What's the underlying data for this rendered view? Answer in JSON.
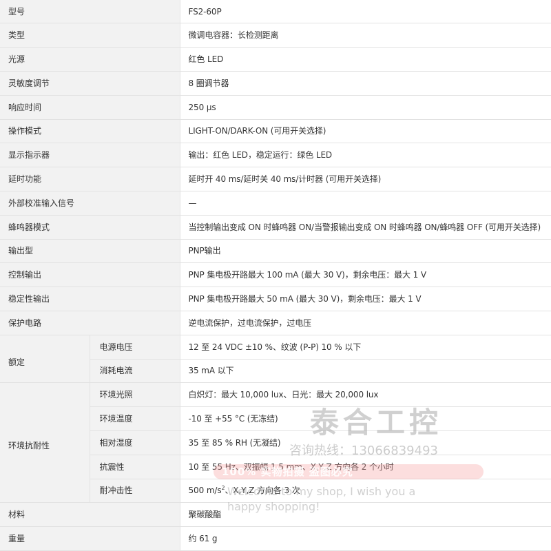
{
  "spec_table": {
    "rows": [
      {
        "label": "型号",
        "value": "FS2-60P"
      },
      {
        "label": "类型",
        "value": "微调电容器：长检测距离"
      },
      {
        "label": "光源",
        "value": "红色 LED"
      },
      {
        "label": "灵敏度调节",
        "value": "8 圈调节器"
      },
      {
        "label": "响应时间",
        "value": "250 μs"
      },
      {
        "label": "操作模式",
        "value": "LIGHT-ON/DARK-ON (可用开关选择)"
      },
      {
        "label": "显示指示器",
        "value": "输出：红色 LED，稳定运行：绿色 LED"
      },
      {
        "label": "延时功能",
        "value": "延时开 40 ms/延时关 40 ms/计时器 (可用开关选择)"
      },
      {
        "label": "外部校准输入信号",
        "value": "—"
      },
      {
        "label": "蜂鸣器模式",
        "value": "当控制输出变成 ON 时蜂鸣器 ON/当警报输出变成 ON 时蜂鸣器 ON/蜂鸣器 OFF (可用开关选择)"
      },
      {
        "label": "输出型",
        "value": "PNP输出"
      },
      {
        "label": "控制输出",
        "value": "PNP 集电极开路最大 100 mA (最大 30 V)，剩余电压：最大 1 V"
      },
      {
        "label": "稳定性输出",
        "value": "PNP 集电极开路最大 50 mA (最大 30 V)，剩余电压：最大 1 V"
      },
      {
        "label": "保护电路",
        "value": "逆电流保护，过电流保护，过电压"
      }
    ],
    "rated": {
      "label": "额定",
      "items": [
        {
          "label": "电源电压",
          "value": "12 至 24 VDC ±10 %、纹波 (P-P) 10 % 以下"
        },
        {
          "label": "消耗电流",
          "value": "35 mA 以下"
        }
      ]
    },
    "environment": {
      "label": "环境抗耐性",
      "items": [
        {
          "label": "环境光照",
          "value": "白炽灯：最大 10,000 lux、日光：最大 20,000 lux"
        },
        {
          "label": "环境温度",
          "value": "-10 至 +55 °C (无冻结)"
        },
        {
          "label": "相对湿度",
          "value": "35 至 85 % RH (无凝结)"
        },
        {
          "label": "抗震性",
          "value": "10 至 55 Hz、双振幅 1.5 mm、X,Y,Z 方向各 2 个小时"
        },
        {
          "label": "耐冲击性",
          "value_prefix": "500 m/s",
          "value_sup": "2",
          "value_suffix": "、X,Y,Z 方向各 3 次"
        }
      ]
    },
    "tail_rows": [
      {
        "label": "材料",
        "value": "聚碳酸酯"
      },
      {
        "label": "重量",
        "value": "约 61 g"
      }
    ]
  },
  "watermark": {
    "brand": "泰合工控",
    "phone": "咨询热线：13066839493",
    "banner": "100% 实物拍摄 盗图必究",
    "english_line1": "Welcome to my shop, I wish you a",
    "english_line2": "happy shopping!"
  }
}
